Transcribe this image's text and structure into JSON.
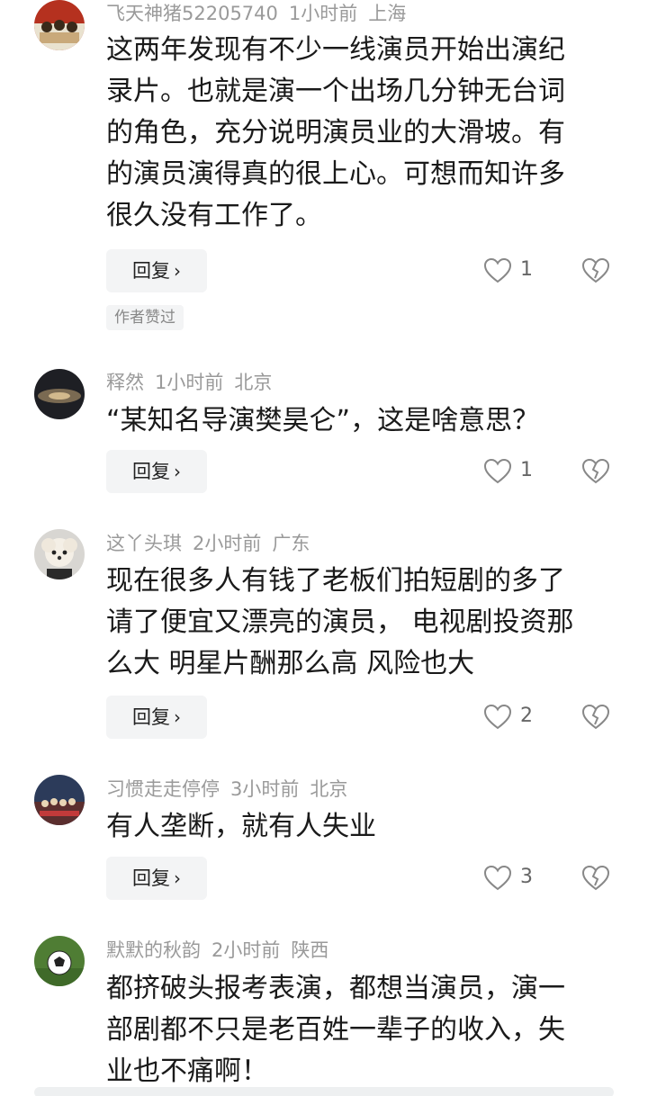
{
  "comments": [
    {
      "username": "飞天神猪52205740",
      "time": "1小时前",
      "location": "上海",
      "lines": [
        "这两年发现有不少一线演员开始出演纪",
        "录片。也就是演一个出场几分钟无台词",
        "的角色，充分说明演员业的大滑坡。有",
        "的演员演得真的很上心。可想而知许多",
        "很久没有工作了。"
      ],
      "reply_label": "回复",
      "likes": "1",
      "author_badge": "作者赞过"
    },
    {
      "username": "释然",
      "time": "1小时前",
      "location": "北京",
      "lines": [
        "“某知名导演樊昊仑”，这是啥意思？"
      ],
      "reply_label": "回复",
      "likes": "1"
    },
    {
      "username": "这丫头琪",
      "time": "2小时前",
      "location": "广东",
      "lines": [
        "现在很多人有钱了老板们拍短剧的多了",
        "请了便宜又漂亮的演员， 电视剧投资那",
        "么大 明星片酬那么高 风险也大"
      ],
      "reply_label": "回复",
      "likes": "2"
    },
    {
      "username": "习惯走走停停",
      "time": "3小时前",
      "location": "北京",
      "lines": [
        "有人垄断，就有人失业"
      ],
      "reply_label": "回复",
      "likes": "3"
    },
    {
      "username": "默默的秋韵",
      "time": "2小时前",
      "location": "陕西",
      "lines": [
        "都挤破头报考表演，都想当演员，演一",
        "部剧都不只是老百姓一辈子的收入，失",
        "业也不痛啊！"
      ]
    }
  ],
  "icons": {
    "like": "heart-outline-icon",
    "dislike": "broken-heart-icon",
    "reply_chevron": "chevron-right-icon"
  },
  "colors": {
    "text": "#1a1a1a",
    "meta": "#9a9a9a",
    "button_bg": "#f3f4f5"
  }
}
